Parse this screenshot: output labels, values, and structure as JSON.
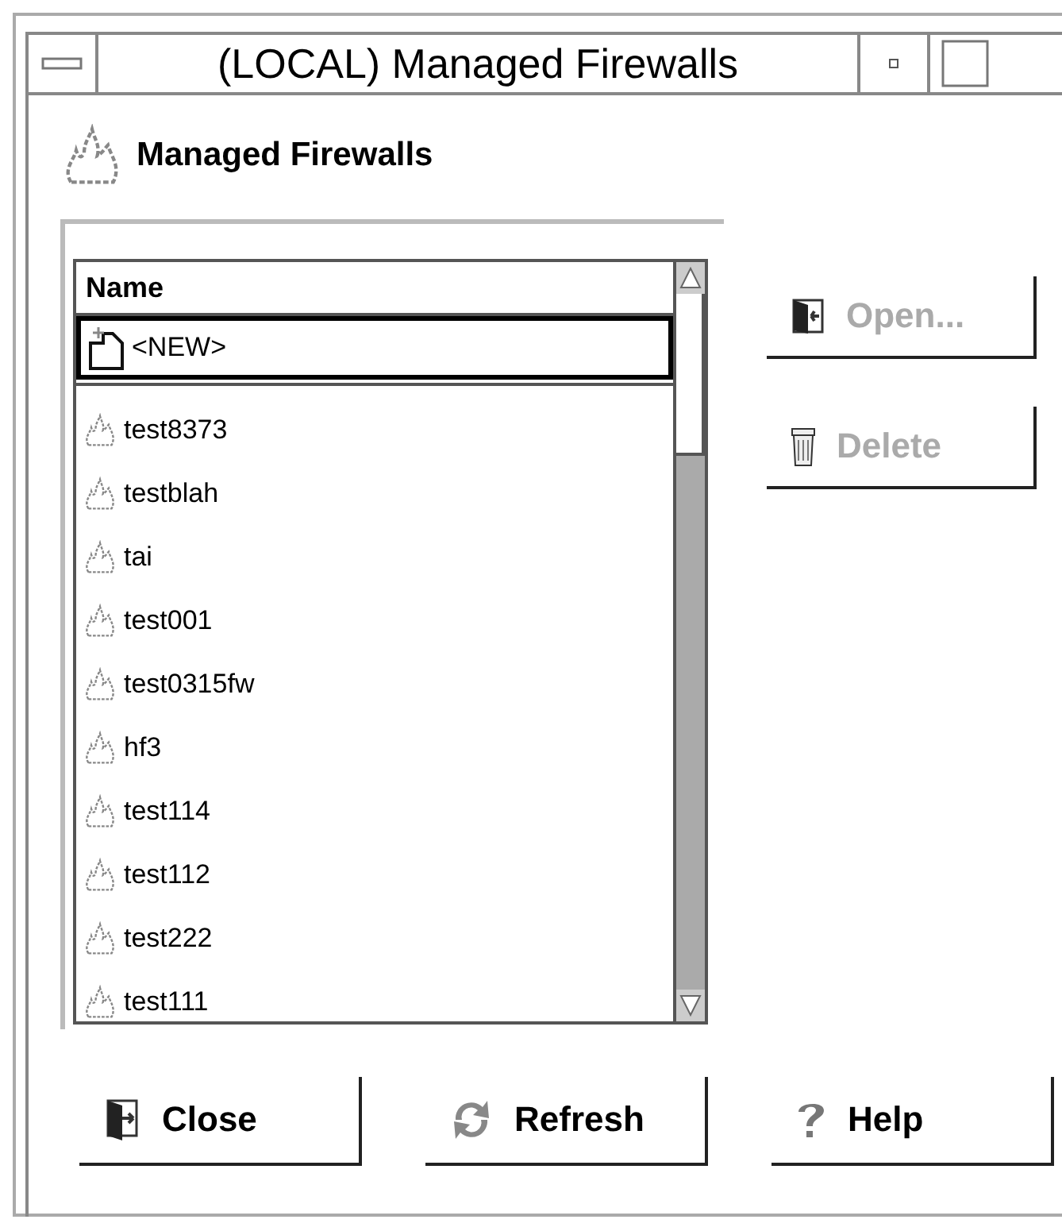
{
  "window": {
    "title": "(LOCAL) Managed Firewalls"
  },
  "header": {
    "title": "Managed Firewalls"
  },
  "list": {
    "column": "Name",
    "new_item": {
      "label": "<NEW>",
      "selected": true
    },
    "items": [
      {
        "label": "test8373",
        "selected": false
      },
      {
        "label": "testblah",
        "selected": false
      },
      {
        "label": "tai",
        "selected": false
      },
      {
        "label": "test001",
        "selected": false
      },
      {
        "label": "test0315fw",
        "selected": false
      },
      {
        "label": "hf3",
        "selected": false
      },
      {
        "label": "test114",
        "selected": false
      },
      {
        "label": "test112",
        "selected": false
      },
      {
        "label": "test222",
        "selected": false
      },
      {
        "label": "test111",
        "selected": false
      }
    ]
  },
  "side_buttons": [
    {
      "kind": "open",
      "label": "Open...",
      "disabled": true
    },
    {
      "kind": "delete",
      "label": "Delete",
      "disabled": true
    }
  ],
  "bottom_buttons": [
    {
      "kind": "close",
      "label": "Close",
      "disabled": false
    },
    {
      "kind": "refresh",
      "label": "Refresh",
      "disabled": false
    },
    {
      "kind": "help",
      "label": "Help",
      "disabled": false
    }
  ]
}
